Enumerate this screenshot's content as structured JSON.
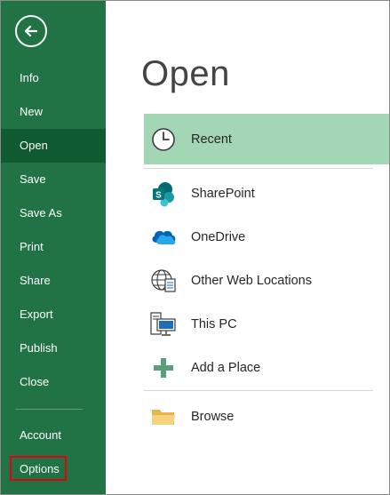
{
  "sidebar": {
    "back_label": "Back",
    "items": [
      {
        "label": "Info"
      },
      {
        "label": "New"
      },
      {
        "label": "Open"
      },
      {
        "label": "Save"
      },
      {
        "label": "Save As"
      },
      {
        "label": "Print"
      },
      {
        "label": "Share"
      },
      {
        "label": "Export"
      },
      {
        "label": "Publish"
      },
      {
        "label": "Close"
      }
    ],
    "bottom": [
      {
        "label": "Account"
      },
      {
        "label": "Options"
      }
    ]
  },
  "main": {
    "title": "Open",
    "locations": [
      {
        "label": "Recent",
        "icon": "clock-icon",
        "active": true
      },
      {
        "label": "SharePoint",
        "icon": "sharepoint-icon"
      },
      {
        "label": "OneDrive",
        "icon": "onedrive-cloud-icon"
      },
      {
        "label": "Other Web Locations",
        "icon": "globe-document-icon"
      },
      {
        "label": "This PC",
        "icon": "computer-icon"
      },
      {
        "label": "Add a Place",
        "icon": "plus-icon"
      },
      {
        "label": "Browse",
        "icon": "folder-icon"
      }
    ]
  },
  "colors": {
    "sidebar_bg": "#217346",
    "sidebar_active": "#0f5a30",
    "recent_highlight": "#a2d6b5",
    "options_outline": "#e3000f"
  }
}
